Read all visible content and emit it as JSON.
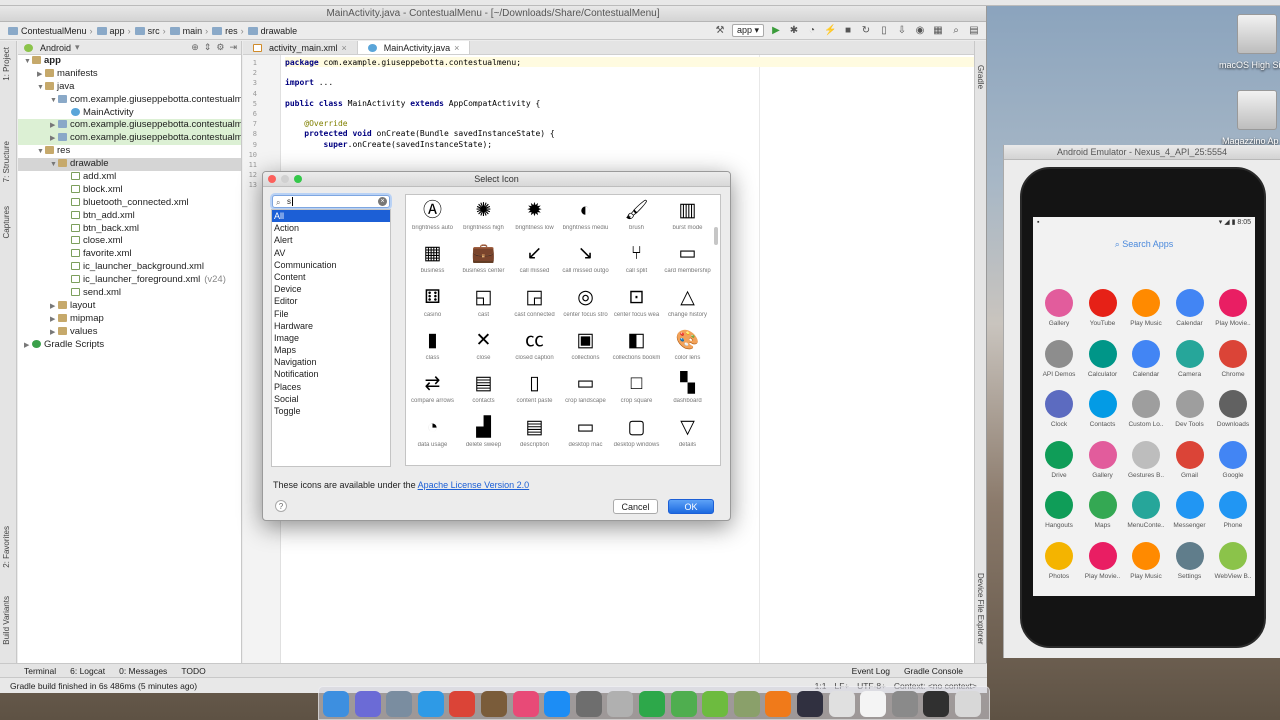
{
  "window": {
    "title": "MainActivity.java - ContestualMenu - [~/Downloads/Share/ContestualMenu]"
  },
  "breadcrumbs": [
    "ContestualMenu",
    "app",
    "src",
    "main",
    "res",
    "drawable"
  ],
  "run_config": "app",
  "project_panel": {
    "view": "Android",
    "tree": [
      {
        "label": "app",
        "indent": 0,
        "type": "folder",
        "expanded": true,
        "style": "bold"
      },
      {
        "label": "manifests",
        "indent": 1,
        "type": "folder",
        "expanded": false
      },
      {
        "label": "java",
        "indent": 1,
        "type": "folder",
        "expanded": true
      },
      {
        "label": "com.example.giuseppebotta.contestualm",
        "indent": 2,
        "type": "pkg",
        "expanded": true
      },
      {
        "label": "MainActivity",
        "indent": 3,
        "type": "cls",
        "expanded": null
      },
      {
        "label": "com.example.giuseppebotta.contestualm",
        "indent": 2,
        "type": "pkg",
        "expanded": false,
        "style": "green"
      },
      {
        "label": "com.example.giuseppebotta.contestualm",
        "indent": 2,
        "type": "pkg",
        "expanded": false,
        "style": "green"
      },
      {
        "label": "res",
        "indent": 1,
        "type": "folder",
        "expanded": true
      },
      {
        "label": "drawable",
        "indent": 2,
        "type": "folder",
        "expanded": true,
        "style": "sel"
      },
      {
        "label": "add.xml",
        "indent": 3,
        "type": "file",
        "expanded": null
      },
      {
        "label": "block.xml",
        "indent": 3,
        "type": "file",
        "expanded": null
      },
      {
        "label": "bluetooth_connected.xml",
        "indent": 3,
        "type": "file",
        "expanded": null
      },
      {
        "label": "btn_add.xml",
        "indent": 3,
        "type": "file",
        "expanded": null
      },
      {
        "label": "btn_back.xml",
        "indent": 3,
        "type": "file",
        "expanded": null
      },
      {
        "label": "close.xml",
        "indent": 3,
        "type": "file",
        "expanded": null
      },
      {
        "label": "favorite.xml",
        "indent": 3,
        "type": "file",
        "expanded": null
      },
      {
        "label": "ic_launcher_background.xml",
        "indent": 3,
        "type": "file",
        "expanded": null
      },
      {
        "label": "ic_launcher_foreground.xml",
        "indent": 3,
        "type": "file",
        "expanded": null,
        "suffix": "(v24)"
      },
      {
        "label": "send.xml",
        "indent": 3,
        "type": "file",
        "expanded": null
      },
      {
        "label": "layout",
        "indent": 2,
        "type": "folder",
        "expanded": false
      },
      {
        "label": "mipmap",
        "indent": 2,
        "type": "folder",
        "expanded": false
      },
      {
        "label": "values",
        "indent": 2,
        "type": "folder",
        "expanded": false
      },
      {
        "label": "Gradle Scripts",
        "indent": 0,
        "type": "gradle",
        "expanded": false
      }
    ]
  },
  "left_tool_tabs": [
    "1: Project",
    "7: Structure",
    "Captures",
    "2: Favorites",
    "Build Variants"
  ],
  "right_tool_tabs": [
    "Gradle",
    "Device File Explorer"
  ],
  "editor": {
    "tabs": [
      {
        "label": "activity_main.xml",
        "active": false
      },
      {
        "label": "MainActivity.java",
        "active": true
      }
    ],
    "line_numbers": [
      "1",
      "2",
      "3",
      "4",
      "5",
      "6",
      "7",
      "8",
      "9",
      "10",
      "11",
      "12",
      "13"
    ],
    "lines": [
      "package com.example.giuseppebotta.contestualmenu;",
      "",
      "import ...",
      "",
      "public class MainActivity extends AppCompatActivity {",
      "",
      "    @Override",
      "    protected void onCreate(Bundle savedInstanceState) {",
      "        super.onCreate(savedInstanceState);"
    ]
  },
  "dialog": {
    "title": "Select Icon",
    "search_value": "s",
    "categories": [
      "All",
      "Action",
      "Alert",
      "AV",
      "Communication",
      "Content",
      "Device",
      "Editor",
      "File",
      "Hardware",
      "Image",
      "Maps",
      "Navigation",
      "Notification",
      "Places",
      "Social",
      "Toggle"
    ],
    "selected_category": "All",
    "icons": [
      {
        "glyph": "Ⓐ",
        "label": "brightness auto"
      },
      {
        "glyph": "✺",
        "label": "brightness high"
      },
      {
        "glyph": "✹",
        "label": "brightness low"
      },
      {
        "glyph": "◐",
        "label": "brightness mediu"
      },
      {
        "glyph": "🖌",
        "label": "brush"
      },
      {
        "glyph": "▥",
        "label": "burst mode"
      },
      {
        "glyph": "▦",
        "label": "business"
      },
      {
        "glyph": "💼",
        "label": "business center"
      },
      {
        "glyph": "↙",
        "label": "call missed"
      },
      {
        "glyph": "↘",
        "label": "call missed outgo"
      },
      {
        "glyph": "⑂",
        "label": "call split"
      },
      {
        "glyph": "▭",
        "label": "card membership"
      },
      {
        "glyph": "⚅",
        "label": "casino"
      },
      {
        "glyph": "◱",
        "label": "cast"
      },
      {
        "glyph": "◲",
        "label": "cast connected"
      },
      {
        "glyph": "◎",
        "label": "center focus stro"
      },
      {
        "glyph": "⊡",
        "label": "center focus wea"
      },
      {
        "glyph": "△",
        "label": "change history"
      },
      {
        "glyph": "▮",
        "label": "class"
      },
      {
        "glyph": "✕",
        "label": "close"
      },
      {
        "glyph": "㏄",
        "label": "closed caption"
      },
      {
        "glyph": "▣",
        "label": "collections"
      },
      {
        "glyph": "◧",
        "label": "collections bookm"
      },
      {
        "glyph": "🎨",
        "label": "color lens"
      },
      {
        "glyph": "⇄",
        "label": "compare arrows"
      },
      {
        "glyph": "▤",
        "label": "contacts"
      },
      {
        "glyph": "▯",
        "label": "content paste"
      },
      {
        "glyph": "▭",
        "label": "crop landscape"
      },
      {
        "glyph": "□",
        "label": "crop square"
      },
      {
        "glyph": "▚",
        "label": "dashboard"
      },
      {
        "glyph": "◔",
        "label": "data usage"
      },
      {
        "glyph": "▟",
        "label": "delete sweep"
      },
      {
        "glyph": "▤",
        "label": "description"
      },
      {
        "glyph": "▭",
        "label": "desktop mac"
      },
      {
        "glyph": "▢",
        "label": "desktop windows"
      },
      {
        "glyph": "▽",
        "label": "details"
      }
    ],
    "license_prefix": "These icons are available under the",
    "license_link": "Apache License Version 2.0",
    "help_label": "?",
    "cancel_label": "Cancel",
    "ok_label": "OK"
  },
  "bottom_tools": {
    "left": [
      "Terminal",
      "6: Logcat",
      "0: Messages",
      "TODO"
    ],
    "right": [
      "Event Log",
      "Gradle Console"
    ]
  },
  "status": {
    "message": "Gradle build finished in 6s 486ms (5 minutes ago)",
    "position": "1:1",
    "line_sep": "LF÷",
    "encoding": "UTF-8÷",
    "context": "Context: <no context>"
  },
  "emulator": {
    "title": "Android Emulator - Nexus_4_API_25:5554",
    "time": "8:05",
    "search_label": "Search Apps",
    "apps": [
      {
        "label": "Gallery",
        "color": "#e25c9c"
      },
      {
        "label": "YouTube",
        "color": "#e62117"
      },
      {
        "label": "Play Music",
        "color": "#ff8a00"
      },
      {
        "label": "Calendar",
        "color": "#4285f4"
      },
      {
        "label": "Play Movie..",
        "color": "#e91e63"
      },
      {
        "label": "API Demos",
        "color": "#8d8d8d"
      },
      {
        "label": "Calculator",
        "color": "#009688"
      },
      {
        "label": "Calendar",
        "color": "#4285f4"
      },
      {
        "label": "Camera",
        "color": "#26a69a"
      },
      {
        "label": "Chrome",
        "color": "#db4437"
      },
      {
        "label": "Clock",
        "color": "#5c6bc0"
      },
      {
        "label": "Contacts",
        "color": "#039be5"
      },
      {
        "label": "Custom Lo..",
        "color": "#9e9e9e"
      },
      {
        "label": "Dev Tools",
        "color": "#9e9e9e"
      },
      {
        "label": "Downloads",
        "color": "#616161"
      },
      {
        "label": "Drive",
        "color": "#0f9d58"
      },
      {
        "label": "Gallery",
        "color": "#e25c9c"
      },
      {
        "label": "Gestures B..",
        "color": "#bdbdbd"
      },
      {
        "label": "Gmail",
        "color": "#db4437"
      },
      {
        "label": "Google",
        "color": "#4285f4"
      },
      {
        "label": "Hangouts",
        "color": "#0f9d58"
      },
      {
        "label": "Maps",
        "color": "#34a853"
      },
      {
        "label": "MenuConte..",
        "color": "#26a69a"
      },
      {
        "label": "Messenger",
        "color": "#2196f3"
      },
      {
        "label": "Phone",
        "color": "#2196f3"
      },
      {
        "label": "Photos",
        "color": "#f4b400"
      },
      {
        "label": "Play Movie..",
        "color": "#e91e63"
      },
      {
        "label": "Play Music",
        "color": "#ff8a00"
      },
      {
        "label": "Settings",
        "color": "#607d8b"
      },
      {
        "label": "WebView B..",
        "color": "#8bc34a"
      }
    ]
  },
  "desktop": {
    "disk1_label": "macOS High Si",
    "disk2_label": "Magazzino Ap"
  }
}
